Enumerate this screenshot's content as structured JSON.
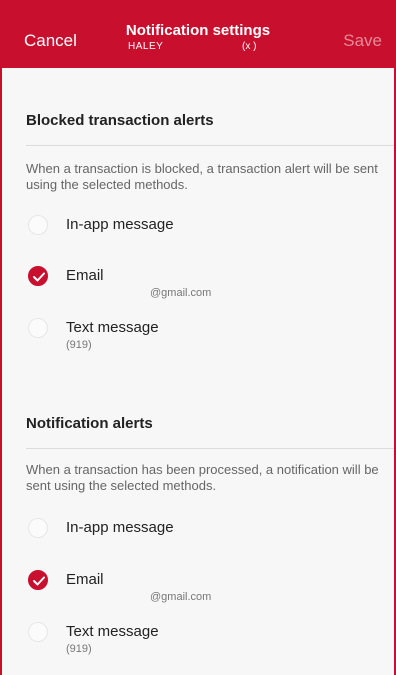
{
  "header": {
    "cancel_label": "Cancel",
    "title": "Notification settings",
    "subtitle_name": "HALEY",
    "subtitle_account": "(x       )",
    "save_label": "Save"
  },
  "sections": [
    {
      "title": "Blocked transaction alerts",
      "description": "When a transaction is blocked, a transaction alert will be sent using the selected methods.",
      "options": [
        {
          "label": "In-app message",
          "detail": "",
          "checked": false
        },
        {
          "label": "Email",
          "detail": "@gmail.com",
          "checked": true
        },
        {
          "label": "Text message",
          "detail": "(919)",
          "checked": false
        }
      ]
    },
    {
      "title": "Notification alerts",
      "description": "When a transaction has been processed, a notification will be sent using the selected methods.",
      "options": [
        {
          "label": "In-app message",
          "detail": "",
          "checked": false
        },
        {
          "label": "Email",
          "detail": "@gmail.com",
          "checked": true
        },
        {
          "label": "Text message",
          "detail": "(919)",
          "checked": false
        }
      ]
    }
  ],
  "colors": {
    "accent": "#c8102e"
  }
}
